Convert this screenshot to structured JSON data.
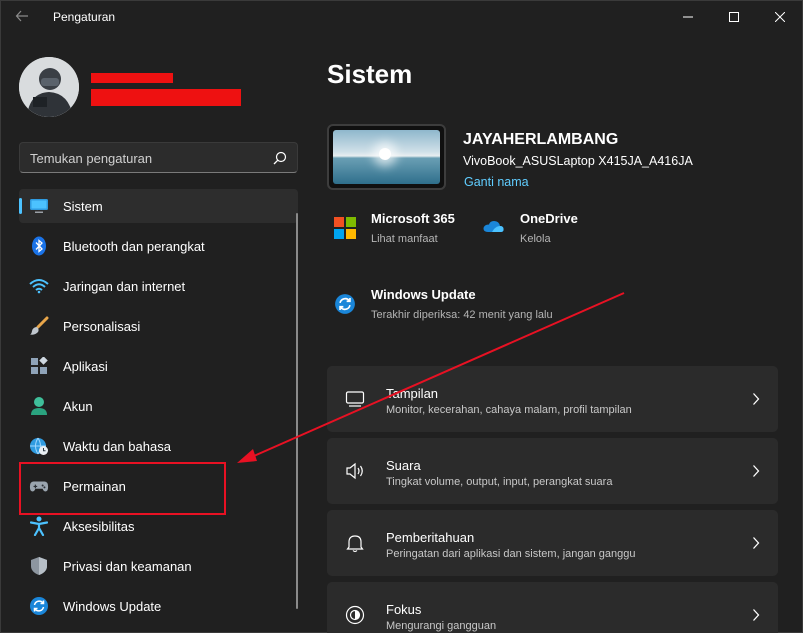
{
  "window": {
    "title": "Pengaturan",
    "controls": {
      "minimize_icon": "minimize-icon",
      "maximize_icon": "maximize-icon",
      "close_icon": "close-icon"
    }
  },
  "profile": {
    "avatar_icon": "user-avatar"
  },
  "search": {
    "placeholder": "Temukan pengaturan",
    "icon": "search-icon"
  },
  "sidebar": {
    "items": [
      {
        "label": "Sistem",
        "icon": "monitor-icon",
        "active": true
      },
      {
        "label": "Bluetooth dan perangkat",
        "icon": "bluetooth-icon"
      },
      {
        "label": "Jaringan dan internet",
        "icon": "wifi-icon"
      },
      {
        "label": "Personalisasi",
        "icon": "brush-icon"
      },
      {
        "label": "Aplikasi",
        "icon": "apps-icon"
      },
      {
        "label": "Akun",
        "icon": "person-icon"
      },
      {
        "label": "Waktu dan bahasa",
        "icon": "globe-clock-icon"
      },
      {
        "label": "Permainan",
        "icon": "gamepad-icon"
      },
      {
        "label": "Aksesibilitas",
        "icon": "accessibility-icon"
      },
      {
        "label": "Privasi dan keamanan",
        "icon": "shield-icon"
      },
      {
        "label": "Windows Update",
        "icon": "update-icon"
      }
    ]
  },
  "main": {
    "title": "Sistem",
    "device": {
      "name": "JAYAHERLAMBANG",
      "model": "VivoBook_ASUSLaptop X415JA_A416JA",
      "rename_label": "Ganti nama"
    },
    "tiles": [
      {
        "title": "Microsoft 365",
        "subtitle": "Lihat manfaat",
        "icon": "microsoft365-icon"
      },
      {
        "title": "OneDrive",
        "subtitle": "Kelola",
        "icon": "onedrive-icon"
      }
    ],
    "windows_update": {
      "title": "Windows Update",
      "subtitle": "Terakhir diperiksa: 42 menit yang lalu",
      "icon": "update-icon"
    },
    "cards": [
      {
        "title": "Tampilan",
        "subtitle": "Monitor, kecerahan, cahaya malam, profil tampilan",
        "icon": "display-icon"
      },
      {
        "title": "Suara",
        "subtitle": "Tingkat volume, output, input, perangkat suara",
        "icon": "speaker-icon"
      },
      {
        "title": "Pemberitahuan",
        "subtitle": "Peringatan dari aplikasi dan sistem, jangan ganggu",
        "icon": "bell-icon"
      },
      {
        "title": "Fokus",
        "subtitle": "Mengurangi gangguan",
        "icon": "focus-icon"
      }
    ]
  },
  "colors": {
    "accent": "#4cc2ff",
    "link": "#60cdff",
    "annotation": "#e81123",
    "background": "#202020",
    "card": "#2b2b2b"
  }
}
